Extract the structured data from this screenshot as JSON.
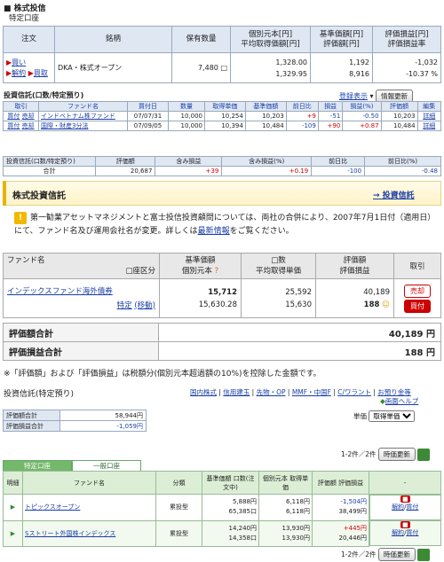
{
  "section1": {
    "title": "■ 株式投信",
    "subtitle": "特定口座",
    "headers": [
      "注文",
      "銘柄",
      "保有数量",
      "個別元本[円]",
      "平均取得価額[円]",
      "基準価額[円]",
      "評価額[円]",
      "評価損益[円]",
      "評価損益率"
    ],
    "row": {
      "buy": "買い",
      "cancel": "解約",
      "kaitori": "買取",
      "fund": "DKA・株式オープン",
      "qty": "7,480",
      "principal": "1,328.00",
      "avg": "1,329.95",
      "base": "1,192",
      "eval": "8,916",
      "pl": "-1,032",
      "plrate": "-10.37 %"
    }
  },
  "section2": {
    "title": "投資信託(口数/特定預り)",
    "link_reg": "登録表示",
    "btn_refresh": "情報更新",
    "headers": [
      "取引",
      "ファンド名",
      "買付日",
      "数量",
      "取得単価",
      "基準価額",
      "前日比",
      "損益",
      "損益(%)",
      "評価額",
      "編集"
    ],
    "rows": [
      {
        "t1": "買付",
        "t2": "売却",
        "fund": "インドベトナム株ファンド",
        "date": "07/07/31",
        "qty": "10,000",
        "cost": "10,254",
        "base": "10,203",
        "diff": "+9",
        "pl": "-51",
        "plp": "-0.50",
        "eval": "10,203",
        "edit": "詳細"
      },
      {
        "t1": "買付",
        "t2": "売却",
        "fund": "国際・財産3分法",
        "date": "07/09/05",
        "qty": "10,000",
        "cost": "10,394",
        "base": "10,484",
        "diff": "-109",
        "pl": "+90",
        "plp": "+0.87",
        "eval": "10,484",
        "edit": "詳細"
      }
    ],
    "summary_headers": [
      "投資信託(口数/特定預り)",
      "評価額",
      "含み損益",
      "含み損益(%)",
      "前日比",
      "前日比(%)"
    ],
    "summary": {
      "label": "合計",
      "eval": "20,687",
      "pl": "+39",
      "plp": "+0.19",
      "diff": "-100",
      "diffp": "-0.48"
    }
  },
  "section3": {
    "bar_title": "株式投資信託",
    "bar_link": "→ 投資信託",
    "notice_pre": "第一勧業アセットマネジメントと富士投信投資顧問については、両社の合併により、2007年7月1日付（適用日）にて、ファンド名及び運用会社名が変更。詳しくは",
    "notice_link": "最新情報",
    "notice_post": "をご覧ください。",
    "headers": {
      "fund": "ファンド名",
      "acct": "□座区分",
      "base": "基準価額",
      "principal": "個別元本",
      "units": "□数",
      "avg": "平均取得単価",
      "eval": "評価額",
      "evalpl": "評価損益",
      "trade": "取引"
    },
    "row": {
      "fund": "インデックスファンド海外債券",
      "acct": "特定",
      "move": "(移動)",
      "base": "15,712",
      "principal": "15,630.28",
      "units": "25,592",
      "avg": "15,630",
      "eval": "40,189",
      "evalpl": "188",
      "sell": "売却",
      "buy": "買付"
    },
    "total_eval_label": "評価額合計",
    "total_eval": "40,189 円",
    "total_pl_label": "評価損益合計",
    "total_pl": "188 円",
    "note": "※「評価額」および「評価損益」は税額分(個別元本超過額の10%)を控除した金額です。"
  },
  "section4": {
    "title": "投資信託(特定預り)",
    "links": [
      "国内株式",
      "信用建玉",
      "先物・OP",
      "MMF・中国F",
      "C/ワラント",
      "お預り金等"
    ],
    "help": "画面ヘルプ",
    "sum_labels": [
      "評価額合計",
      "評価損益合計"
    ],
    "sum_values": [
      "58,944円",
      "-1,059円"
    ],
    "unit_label": "単価",
    "unit_select": "取得単価",
    "count": "1-2件／2件",
    "btn_refresh": "時価更新",
    "tabs": [
      "特定口座",
      "一般口座"
    ],
    "headers": [
      "明細",
      "ファンド名",
      "分類",
      "基準価額 口数(注文中)",
      "個別元本 取得単価",
      "評価額 評価損益",
      "-"
    ],
    "rows": [
      {
        "fund": "トピックスオープン",
        "cat": "累投型",
        "base": "5,888円",
        "units": "65,385口",
        "principal": "6,118円",
        "cost": "6,118円",
        "pl": "-1,504円",
        "eval": "38,499円",
        "act1": "解約",
        "act2": "買付"
      },
      {
        "fund": "Sストリート外国株インデックス",
        "cat": "累投型",
        "base": "14,240円",
        "units": "14,358口",
        "principal": "13,930円",
        "cost": "13,930円",
        "pl": "+445円",
        "eval": "20,446円",
        "act1": "解約",
        "act2": "買付"
      }
    ],
    "count2": "1-2件／2件"
  }
}
